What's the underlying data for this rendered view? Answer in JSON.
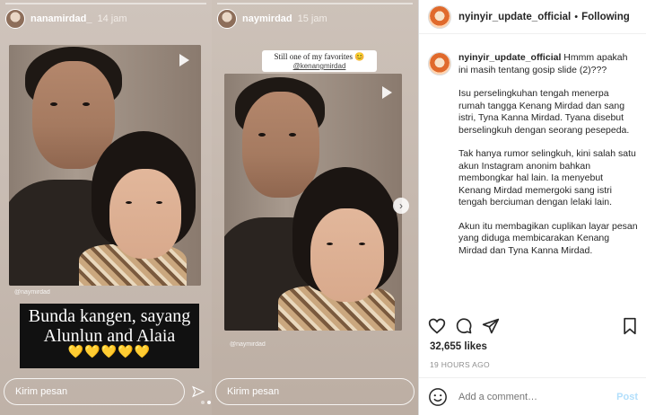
{
  "stories": [
    {
      "username": "nanamirdad_",
      "time": "14 jam",
      "mention": "@naymirdad",
      "caption_line1": "Bunda kangen, sayang",
      "caption_line2": "Alunlun and Alaia",
      "hearts": "💛💛💛💛💛",
      "reply_placeholder": "Kirim pesan"
    },
    {
      "username": "naymirdad",
      "time": "15 jam",
      "sticker_title": "Still one of my favorites 😊",
      "sticker_tag": "@kenangmirdad",
      "mention": "@naymirdad",
      "reply_placeholder": "Kirim pesan"
    }
  ],
  "post": {
    "username": "nyinyir_update_official",
    "separator": "•",
    "follow_status": "Following",
    "caption_user": "nyinyir_update_official",
    "caption_intro": " Hmmm apakah ini masih tentang gosip slide (2)???",
    "paragraphs": [
      "Isu perselingkuhan tengah menerpa rumah tangga Kenang Mirdad dan sang istri, Tyna Kanna Mirdad. Tyana disebut berselingkuh dengan seorang pesepeda.",
      "Tak hanya rumor selingkuh, kini salah satu akun Instagram anonim bahkan membongkar hal lain. Ia menyebut Kenang Mirdad memergoki sang istri tengah berciuman dengan lelaki lain.",
      "Akun itu membagikan cuplikan layar pesan yang diduga membicarakan Kenang Mirdad dan Tyna Kanna Mirdad."
    ],
    "likes": "32,655 likes",
    "time_ago": "19 HOURS AGO",
    "comment_placeholder": "Add a comment…",
    "post_label": "Post"
  },
  "icons": {
    "like": "heart-icon",
    "comment": "comment-icon",
    "share": "send-icon",
    "save": "bookmark-icon",
    "emoji": "emoji-icon",
    "play": "play-icon",
    "next": "chevron-right-icon"
  },
  "colors": {
    "link_blue_disabled": "#b2dffc",
    "text_primary": "#262626",
    "text_secondary": "#8e8e8e",
    "heart_yellow": "#f5c518"
  }
}
